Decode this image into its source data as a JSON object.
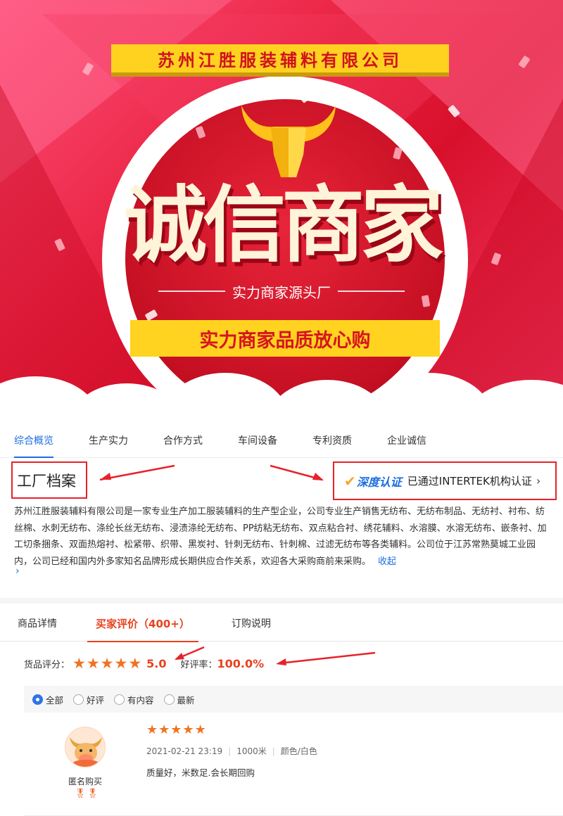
{
  "banner": {
    "company_name": "苏州江胜服装辅料有限公司",
    "headline": "诚信商家",
    "subline": "实力商家源头厂",
    "slogan": "实力商家品质放心购"
  },
  "company_tabs": [
    {
      "label": "综合概览",
      "active": true
    },
    {
      "label": "生产实力",
      "active": false
    },
    {
      "label": "合作方式",
      "active": false
    },
    {
      "label": "车间设备",
      "active": false
    },
    {
      "label": "专利资质",
      "active": false
    },
    {
      "label": "企业诚信",
      "active": false
    }
  ],
  "factory": {
    "title": "工厂档案",
    "cert_logo": "深度认证",
    "cert_text": "已通过INTERTEK机构认证",
    "description": "苏州江胜服装辅料有限公司是一家专业生产加工服装辅料的生产型企业，公司专业生产销售无纺布、无纺布制品、无纺衬、衬布、纺丝棉、水刺无纺布、涤纶长丝无纺布、浸渍涤纶无纺布、PP纺粘无纺布、双点粘合衬、绣花辅料、水溶膜、水溶无纺布、嵌条衬、加工切条捆条、双面热熔衬、松紧带、织带、黑炭衬、针刺无纺布、针刺棉、过滤无纺布等各类辅料。公司位于江苏常熟莫城工业园内，公司已经和国内外多家知名品牌形成长期供应合作关系，欢迎各大采购商前来采购。",
    "fold_label": "收起"
  },
  "product_tabs": [
    {
      "label": "商品详情"
    },
    {
      "label": "买家评价（400+）"
    },
    {
      "label": "订购说明"
    }
  ],
  "rating": {
    "label": "货品评分：",
    "score": "5.0",
    "stars": 5,
    "good_label": "好评率：",
    "good_rate": "100.0%"
  },
  "filters": [
    {
      "label": "全部",
      "checked": true
    },
    {
      "label": "好评",
      "checked": false
    },
    {
      "label": "有内容",
      "checked": false
    },
    {
      "label": "最新",
      "checked": false
    }
  ],
  "review": {
    "reviewer": "匿名购买",
    "stars": 5,
    "date": "2021-02-21 23:19",
    "quantity": "1000米",
    "spec": "颜色/白色",
    "text": "质量好，米数足.会长期回购"
  },
  "colors": {
    "accent_blue": "#1a6ee0",
    "accent_orange": "#e8411f",
    "star": "#f07322",
    "annotation_red": "#e6222a",
    "banner_yellow": "#ffd21f"
  }
}
